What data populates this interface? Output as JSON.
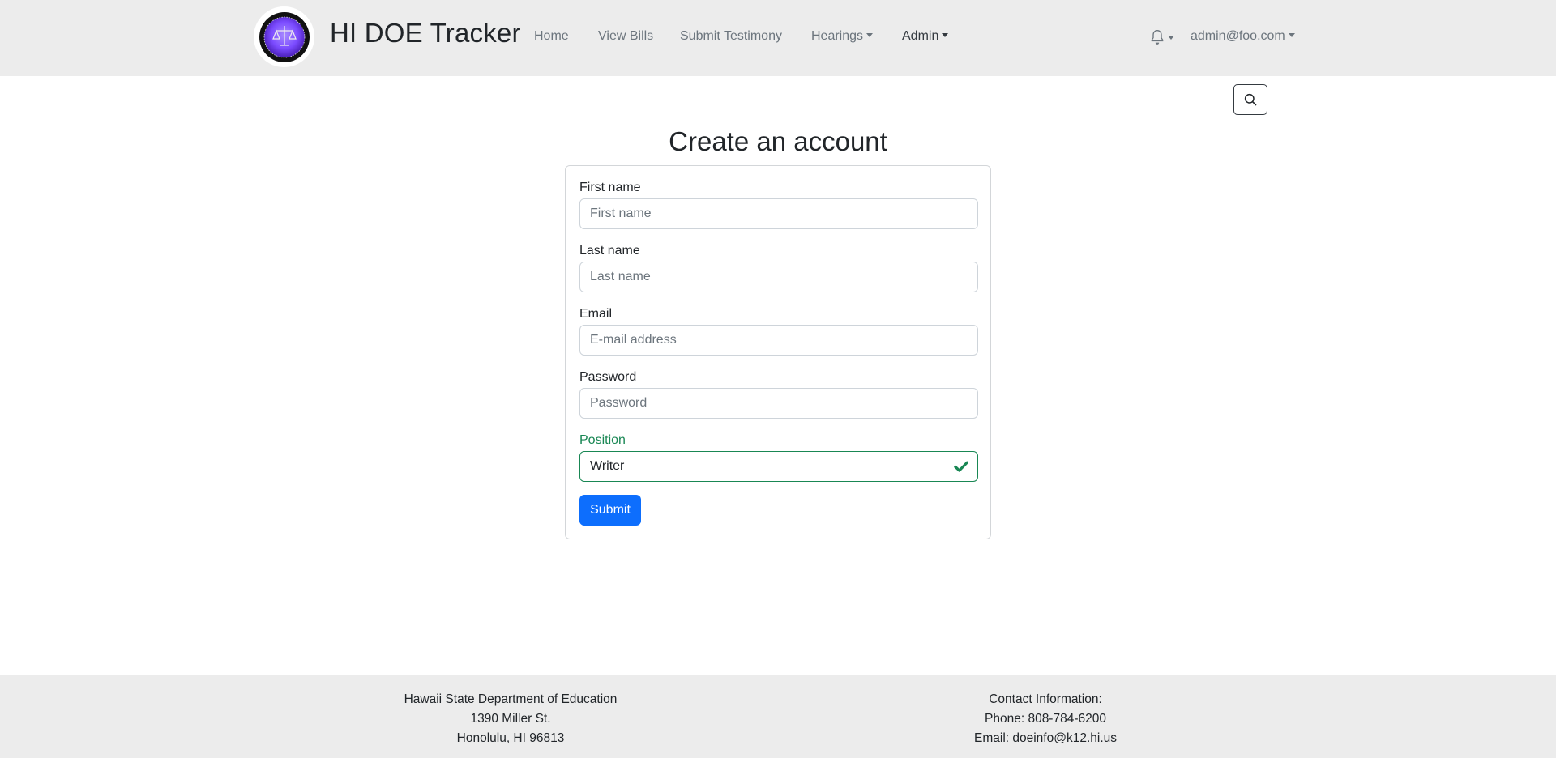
{
  "navbar": {
    "brand_title": "HI DOE Tracker",
    "links": [
      "Home",
      "View Bills",
      "Submit Testimony"
    ],
    "hearings_label": "Hearings",
    "admin_label": "Admin",
    "user_email": "admin@foo.com"
  },
  "form": {
    "title": "Create an account",
    "first_name": {
      "label": "First name",
      "placeholder": "First name",
      "value": ""
    },
    "last_name": {
      "label": "Last name",
      "placeholder": "Last name",
      "value": ""
    },
    "email": {
      "label": "Email",
      "placeholder": "E-mail address",
      "value": ""
    },
    "password": {
      "label": "Password",
      "placeholder": "Password",
      "value": ""
    },
    "position": {
      "label": "Position",
      "value": "Writer"
    },
    "submit_label": "Submit"
  },
  "footer": {
    "left": [
      "Hawaii State Department of Education",
      "1390 Miller St.",
      "Honolulu, HI 96813"
    ],
    "right": [
      "Contact Information:",
      "Phone: 808-784-6200",
      "Email: doeinfo@k12.hi.us"
    ]
  },
  "colors": {
    "primary": "#0d6efd",
    "valid": "#198754",
    "navbar_bg": "#ececec"
  },
  "icons": [
    "logo-seal-icon",
    "bell-icon",
    "search-icon",
    "check-icon"
  ]
}
